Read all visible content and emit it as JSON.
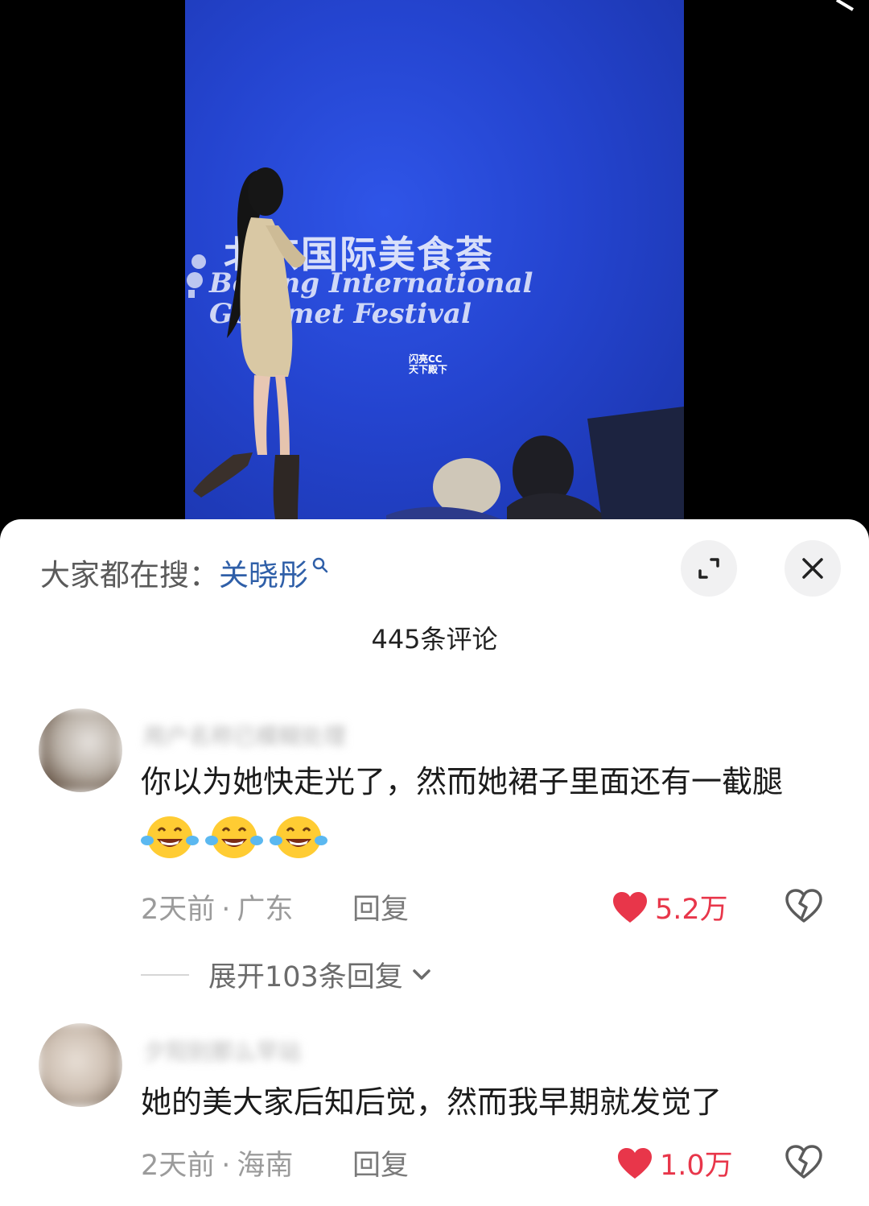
{
  "video": {
    "festival_cn": "北京国际美食荟",
    "festival_en_line1": "Beijing International",
    "festival_en_line2": "Gourmet Festival",
    "watermark_line1": "闪亮CC",
    "watermark_line2": "天下殿下"
  },
  "search": {
    "prefix": "大家都在搜：",
    "term": "关晓彤"
  },
  "comments_header": {
    "count_label": "445条评论"
  },
  "comments": [
    {
      "username": "用户名称已模糊处理",
      "text": "你以为她快走光了，然而她裙子里面还有一截腿",
      "emojis": [
        "laugh-cry-emoji",
        "laugh-cry-emoji",
        "laugh-cry-emoji"
      ],
      "time": "2天前",
      "location": "广东",
      "reply_label": "回复",
      "likes": "5.2万",
      "expand_label": "展开103条回复"
    },
    {
      "username": "夕阳别那么早站",
      "text": "她的美大家后知后觉，然而我早期就发觉了",
      "time": "2天前",
      "location": "海南",
      "reply_label": "回复",
      "likes": "1.0万"
    }
  ],
  "colors": {
    "video_blue": "#2444cf",
    "search_term": "#2f5fa8",
    "like_red": "#e8364a",
    "sheet_bg": "#ffffff"
  },
  "icons": [
    "search-icon",
    "expand-icon",
    "close-icon",
    "heart-icon",
    "broken-heart-icon",
    "chevron-down-icon"
  ]
}
